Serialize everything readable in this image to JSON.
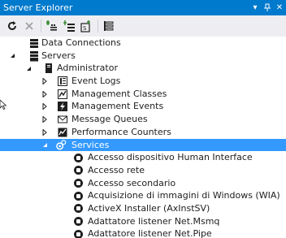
{
  "window": {
    "title": "Server Explorer",
    "pin_glyph": "↓",
    "close_glyph": "✕",
    "menu_glyph": "▾"
  },
  "toolbar": {
    "buttons": [
      {
        "name": "refresh-icon"
      },
      {
        "name": "stop-icon"
      },
      {
        "name": "connect-to-database-icon"
      },
      {
        "name": "connect-to-server-icon"
      },
      {
        "name": "connect-to-sharepoint-icon"
      },
      {
        "name": "properties-icon"
      }
    ]
  },
  "tree": {
    "data_connections": "Data Connections",
    "servers": "Servers",
    "administrator": "Administrator",
    "event_logs": "Event Logs",
    "management_classes": "Management Classes",
    "management_events": "Management Events",
    "message_queues": "Message Queues",
    "performance_counters": "Performance Counters",
    "services": "Services",
    "service_items": [
      "Accesso dispositivo Human Interface",
      "Accesso rete",
      "Accesso secondario",
      "Acquisizione di immagini di Windows (WIA)",
      "ActiveX Installer (AxInstSV)",
      "Adattatore listener Net.Msmq",
      "Adattatore listener Net.Pipe"
    ]
  },
  "colors": {
    "titlebar": "#007acc",
    "toolbar": "#eeeef2",
    "selection": "#3399ff",
    "text": "#1e1e1e"
  }
}
